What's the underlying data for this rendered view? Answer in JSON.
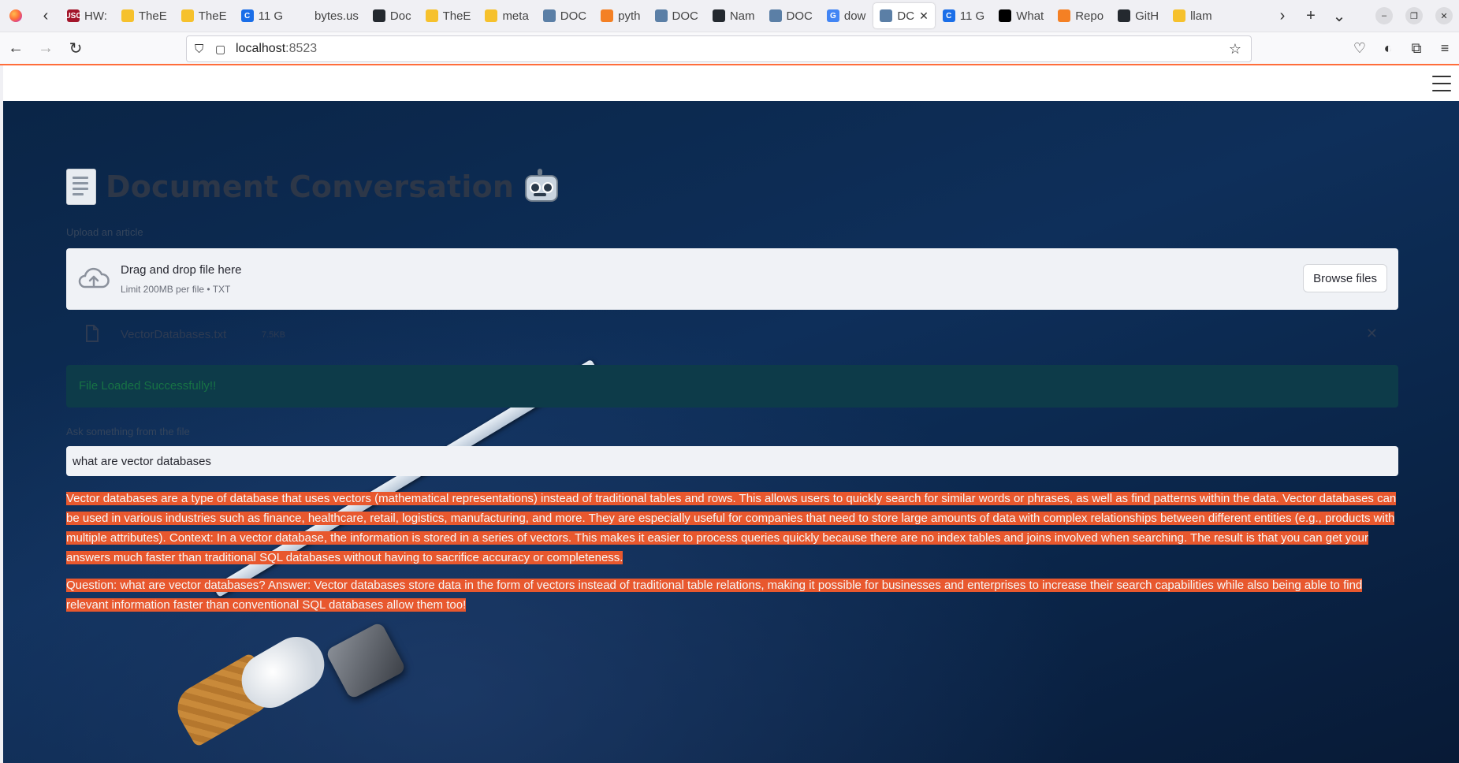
{
  "browser": {
    "tabs": [
      {
        "title": "HW:",
        "fav_color": "#a3152a",
        "fav_text": "USC"
      },
      {
        "title": "TheE",
        "fav_color": "#f6c12c",
        "fav_text": ""
      },
      {
        "title": "TheE",
        "fav_color": "#f6c12c",
        "fav_text": ""
      },
      {
        "title": "11 G",
        "fav_color": "#1a6ee8",
        "fav_text": "C"
      },
      {
        "title": "bytes.us",
        "fav_color": "",
        "fav_text": ""
      },
      {
        "title": "Doc",
        "fav_color": "#24292f",
        "fav_text": ""
      },
      {
        "title": "TheE",
        "fav_color": "#f6c12c",
        "fav_text": ""
      },
      {
        "title": "meta",
        "fav_color": "#f6c12c",
        "fav_text": ""
      },
      {
        "title": "DOC",
        "fav_color": "#5b7fa6",
        "fav_text": ""
      },
      {
        "title": "pyth",
        "fav_color": "#f48024",
        "fav_text": ""
      },
      {
        "title": "DOC",
        "fav_color": "#5b7fa6",
        "fav_text": ""
      },
      {
        "title": "Nam",
        "fav_color": "#24292f",
        "fav_text": ""
      },
      {
        "title": "DOC",
        "fav_color": "#5b7fa6",
        "fav_text": ""
      },
      {
        "title": "dow",
        "fav_color": "#4285f4",
        "fav_text": "G"
      },
      {
        "title": "DC",
        "fav_color": "#5b7fa6",
        "fav_text": "",
        "active": true
      },
      {
        "title": "11 G",
        "fav_color": "#1a6ee8",
        "fav_text": "C"
      },
      {
        "title": "What",
        "fav_color": "#000000",
        "fav_text": ""
      },
      {
        "title": "Repo",
        "fav_color": "#f48024",
        "fav_text": ""
      },
      {
        "title": "GitH",
        "fav_color": "#24292f",
        "fav_text": ""
      },
      {
        "title": "llam",
        "fav_color": "#f6c12c",
        "fav_text": ""
      }
    ],
    "url_host": "localhost",
    "url_port": ":8523"
  },
  "app": {
    "title": "Document Conversation",
    "upload_label": "Upload an article",
    "uploader": {
      "title": "Drag and drop file here",
      "subtitle": "Limit 200MB per file • TXT",
      "browse_label": "Browse files"
    },
    "file": {
      "name": "VectorDatabases.txt",
      "size": "7.5KB"
    },
    "success_message": "File Loaded Successfully!!",
    "question_label": "Ask something from the file",
    "question_value": "what are vector databases",
    "answer_paragraphs": [
      "Vector databases are a type of database that uses vectors (mathematical representations) instead of traditional tables and rows. This allows users to quickly search for similar words or phrases, as well as find patterns within the data. Vector databases can be used in various industries such as finance, healthcare, retail, logistics, manufacturing, and more. They are especially useful for companies that need to store large amounts of data with complex relationships between different entities (e.g., products with multiple attributes). Context: In a vector database, the information is stored in a series of vectors. This makes it easier to process queries quickly because there are no index tables and joins involved when searching. The result is that you can get your answers much faster than traditional SQL databases without having to sacrifice accuracy or completeness.",
      "Question: what are vector databases? Answer: Vector databases store data in the form of vectors instead of traditional table relations, making it possible for businesses and enterprises to increase their search capabilities while also being able to find relevant information faster than conventional SQL databases allow them too!"
    ]
  },
  "colors": {
    "accent_highlight": "#e8582e",
    "success_text": "#177245",
    "title_text": "#2d3748"
  }
}
